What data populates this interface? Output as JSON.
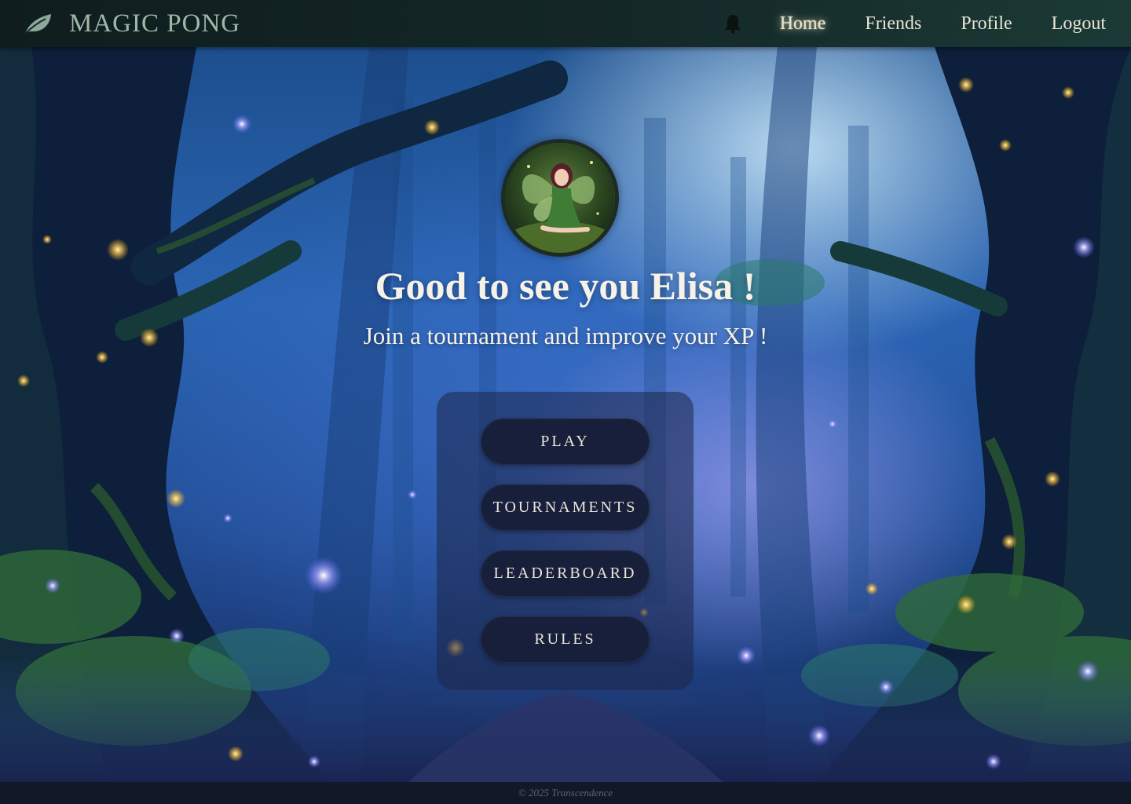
{
  "app": {
    "brand_title": "MAGIC PONG",
    "brand_icon": "leaf-icon"
  },
  "nav": {
    "notification_icon": "bell-icon",
    "links": [
      {
        "label": "Home",
        "active": true
      },
      {
        "label": "Friends",
        "active": false
      },
      {
        "label": "Profile",
        "active": false
      },
      {
        "label": "Logout",
        "active": false
      }
    ]
  },
  "main": {
    "avatar_icon": "fairy-avatar",
    "greeting": "Good to see you Elisa !",
    "subtitle": "Join a tournament and improve your XP !",
    "menu": [
      {
        "label": "PLAY"
      },
      {
        "label": "TOURNAMENTS"
      },
      {
        "label": "LEADERBOARD"
      },
      {
        "label": "RULES"
      }
    ]
  },
  "footer": {
    "text": "© 2025 Transcendence"
  },
  "colors": {
    "navbar": "#142727",
    "brand": "#9fb8a6",
    "button_bg": "#181f3a",
    "panel_bg": "#1e2648",
    "footer_bg": "#111827"
  }
}
